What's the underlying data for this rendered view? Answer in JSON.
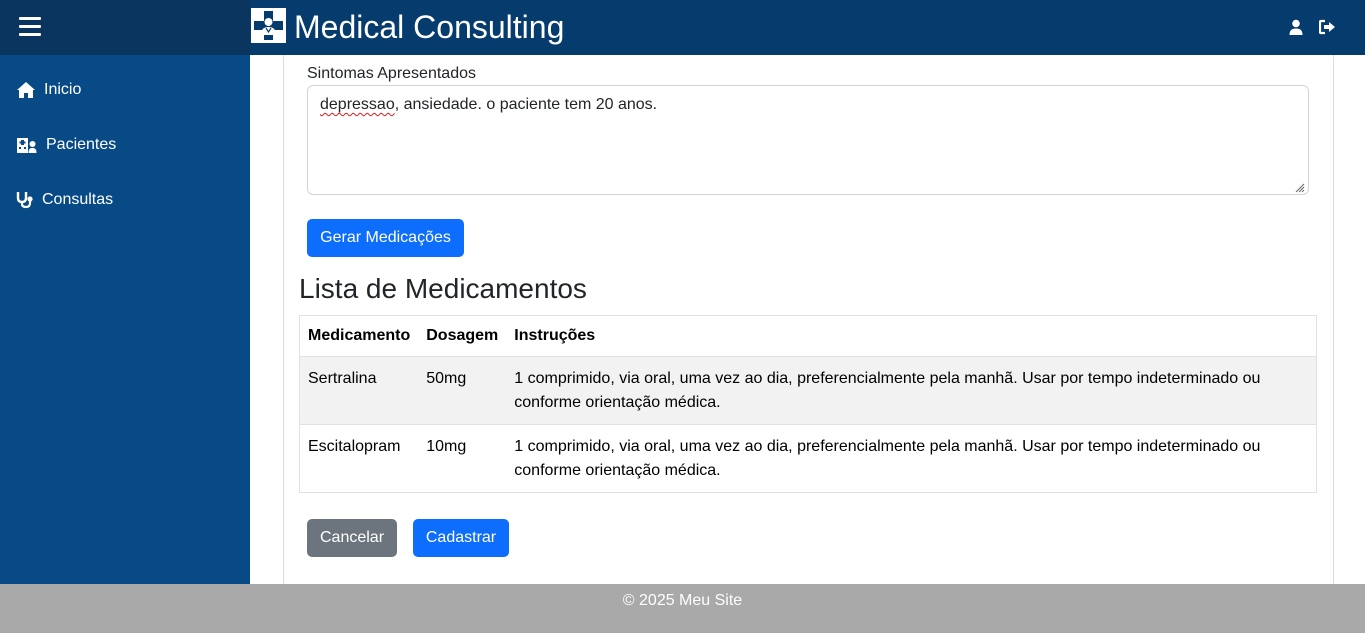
{
  "header": {
    "title": "Medical Consulting",
    "menu_icon": "hamburger-icon",
    "logo_icon": "medical-cross-doctor-logo",
    "user_icon": "user-icon",
    "logout_icon": "sign-out-icon",
    "colors": {
      "bar": "#063b6e",
      "toggle_area": "#0a355f"
    }
  },
  "sidebar": {
    "background": "#084a86",
    "items": [
      {
        "label": "Inicio",
        "icon": "home-icon"
      },
      {
        "label": "Pacientes",
        "icon": "hospital-user-icon"
      },
      {
        "label": "Consultas",
        "icon": "stethoscope-icon"
      }
    ]
  },
  "form": {
    "symptoms_label": "Sintomas Apresentados",
    "symptoms_value_typo": "depressao",
    "symptoms_value_rest": ", ansiedade. o paciente tem 20 anos.",
    "generate_button": "Gerar Medicações"
  },
  "medications": {
    "title": "Lista de Medicamentos",
    "columns": [
      "Medicamento",
      "Dosagem",
      "Instruções"
    ],
    "rows": [
      {
        "name": "Sertralina",
        "dose": "50mg",
        "instructions": "1 comprimido, via oral, uma vez ao dia, preferencialmente pela manhã. Usar por tempo indeterminado ou conforme orientação médica."
      },
      {
        "name": "Escitalopram",
        "dose": "10mg",
        "instructions": "1 comprimido, via oral, uma vez ao dia, preferencialmente pela manhã. Usar por tempo indeterminado ou conforme orientação médica."
      }
    ]
  },
  "actions": {
    "cancel": "Cancelar",
    "submit": "Cadastrar",
    "colors": {
      "primary": "#0d6efd",
      "secondary": "#6c757d"
    }
  },
  "footer": {
    "text": "© 2025 Meu Site",
    "background": "#a9a9a9"
  }
}
